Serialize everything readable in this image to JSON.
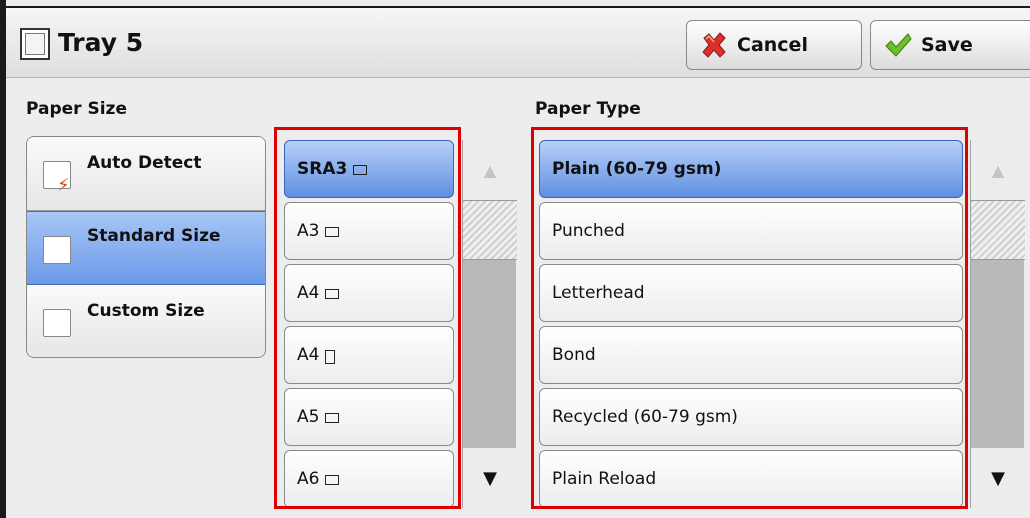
{
  "header": {
    "title": "Tray 5",
    "cancel_label": "Cancel",
    "save_label": "Save"
  },
  "paper_size": {
    "label": "Paper Size",
    "modes": [
      {
        "label": "Auto Detect",
        "selected": false
      },
      {
        "label": "Standard Size",
        "selected": true
      },
      {
        "label": "Custom Size",
        "selected": false
      }
    ],
    "sizes": [
      {
        "label": "SRA3",
        "orientation": "landscape",
        "selected": true
      },
      {
        "label": "A3",
        "orientation": "landscape",
        "selected": false
      },
      {
        "label": "A4",
        "orientation": "landscape",
        "selected": false
      },
      {
        "label": "A4",
        "orientation": "portrait",
        "selected": false
      },
      {
        "label": "A5",
        "orientation": "landscape",
        "selected": false
      },
      {
        "label": "A6",
        "orientation": "landscape",
        "selected": false
      }
    ]
  },
  "paper_type": {
    "label": "Paper Type",
    "items": [
      {
        "label": "Plain (60-79 gsm)",
        "selected": true
      },
      {
        "label": "Punched",
        "selected": false
      },
      {
        "label": "Letterhead",
        "selected": false
      },
      {
        "label": "Bond",
        "selected": false
      },
      {
        "label": "Recycled (60-79 gsm)",
        "selected": false
      },
      {
        "label": "Plain Reload",
        "selected": false
      }
    ]
  },
  "icons": {
    "tray": "tray-icon",
    "cancel": "cancel-x-icon",
    "save": "checkmark-icon",
    "scroll_up": "▲",
    "scroll_down": "▼"
  },
  "colors": {
    "selection": "#6b9ae8",
    "highlight_box": "#e00000",
    "cancel_icon": "#d9302a",
    "save_icon": "#6cc02a"
  }
}
